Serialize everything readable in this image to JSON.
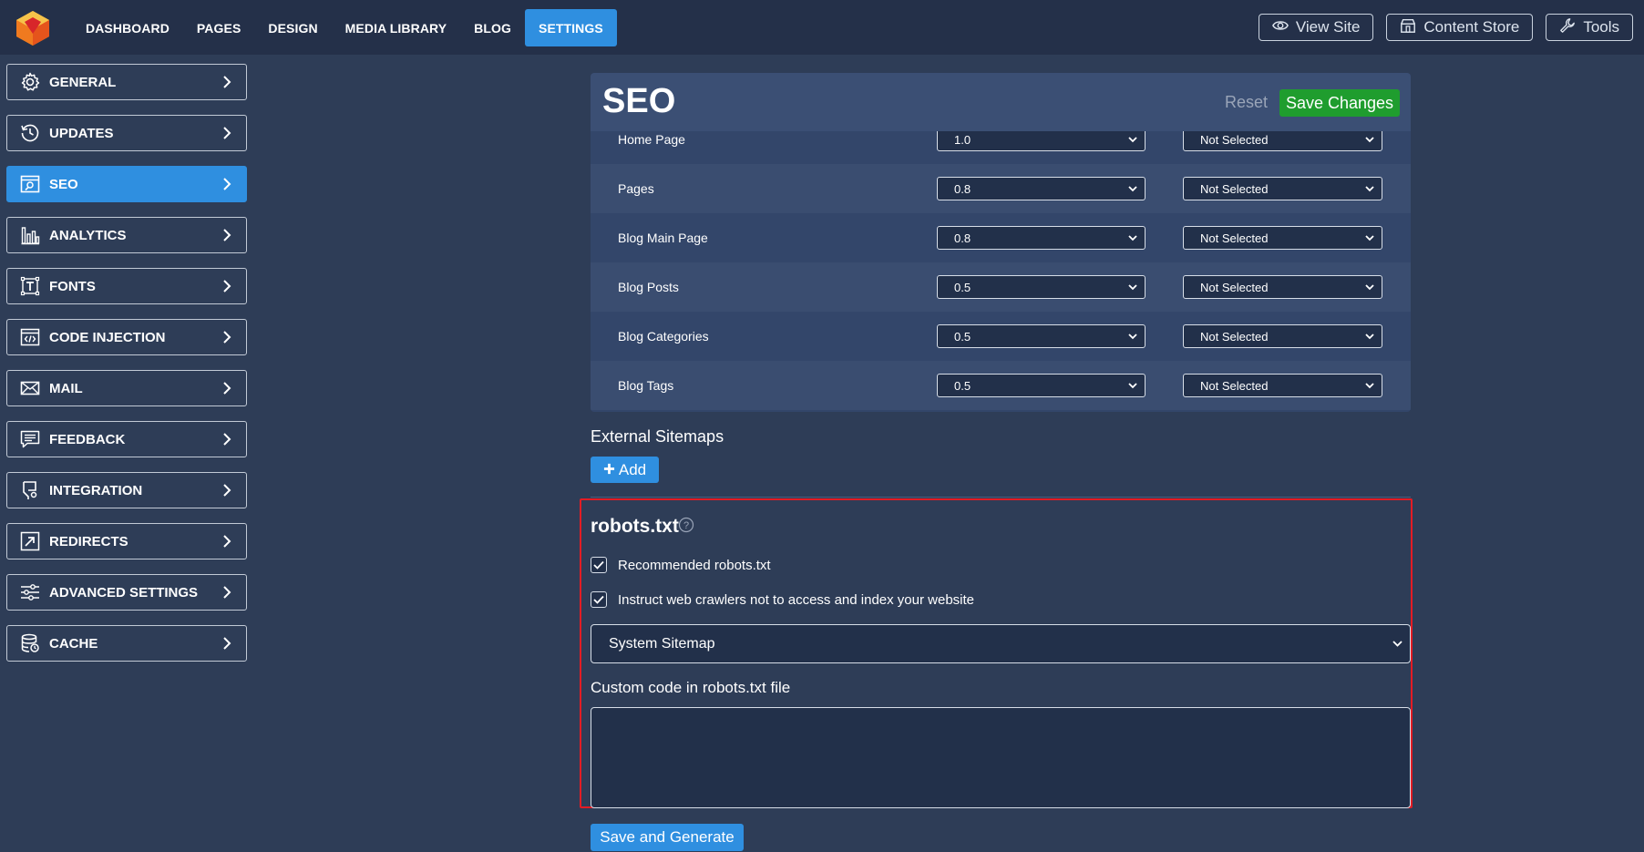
{
  "nav": {
    "items": [
      {
        "label": "DASHBOARD",
        "active": false
      },
      {
        "label": "PAGES",
        "active": false
      },
      {
        "label": "DESIGN",
        "active": false
      },
      {
        "label": "MEDIA LIBRARY",
        "active": false
      },
      {
        "label": "BLOG",
        "active": false
      },
      {
        "label": "SETTINGS",
        "active": true
      }
    ],
    "actions": {
      "view_site": "View Site",
      "content_store": "Content Store",
      "tools": "Tools"
    }
  },
  "sidebar": {
    "items": [
      {
        "label": "GENERAL",
        "icon": "gear-icon"
      },
      {
        "label": "UPDATES",
        "icon": "history-icon"
      },
      {
        "label": "SEO",
        "icon": "seo-icon",
        "active": true
      },
      {
        "label": "ANALYTICS",
        "icon": "analytics-icon"
      },
      {
        "label": "FONTS",
        "icon": "fonts-icon"
      },
      {
        "label": "CODE INJECTION",
        "icon": "code-icon"
      },
      {
        "label": "MAIL",
        "icon": "mail-icon"
      },
      {
        "label": "FEEDBACK",
        "icon": "feedback-icon"
      },
      {
        "label": "INTEGRATION",
        "icon": "integration-icon"
      },
      {
        "label": "REDIRECTS",
        "icon": "redirect-icon"
      },
      {
        "label": "ADVANCED SETTINGS",
        "icon": "sliders-icon"
      },
      {
        "label": "CACHE",
        "icon": "database-icon"
      }
    ]
  },
  "seo": {
    "title": "SEO",
    "reset_label": "Reset",
    "save_label": "Save Changes",
    "sitemap_rows": [
      {
        "label": "Home Page",
        "priority": "1.0",
        "frequency": "Not Selected"
      },
      {
        "label": "Pages",
        "priority": "0.8",
        "frequency": "Not Selected"
      },
      {
        "label": "Blog Main Page",
        "priority": "0.8",
        "frequency": "Not Selected"
      },
      {
        "label": "Blog Posts",
        "priority": "0.5",
        "frequency": "Not Selected"
      },
      {
        "label": "Blog Categories",
        "priority": "0.5",
        "frequency": "Not Selected"
      },
      {
        "label": "Blog Tags",
        "priority": "0.5",
        "frequency": "Not Selected"
      }
    ],
    "external_sitemaps": {
      "title": "External Sitemaps",
      "add_label": "Add"
    },
    "robots": {
      "title": "robots.txt",
      "recommended_label": "Recommended robots.txt",
      "recommended_checked": true,
      "noindex_label": "Instruct web crawlers not to access and index your website",
      "noindex_checked": true,
      "sitemap_select": "System Sitemap",
      "custom_code_label": "Custom code in robots.txt file",
      "custom_code_value": "",
      "generate_label": "Save and Generate"
    }
  },
  "colors": {
    "accent": "#2f8fe0",
    "save": "#1f9d2e",
    "highlight": "#e31c24",
    "background": "#2e3d57",
    "topbar": "#243049"
  }
}
